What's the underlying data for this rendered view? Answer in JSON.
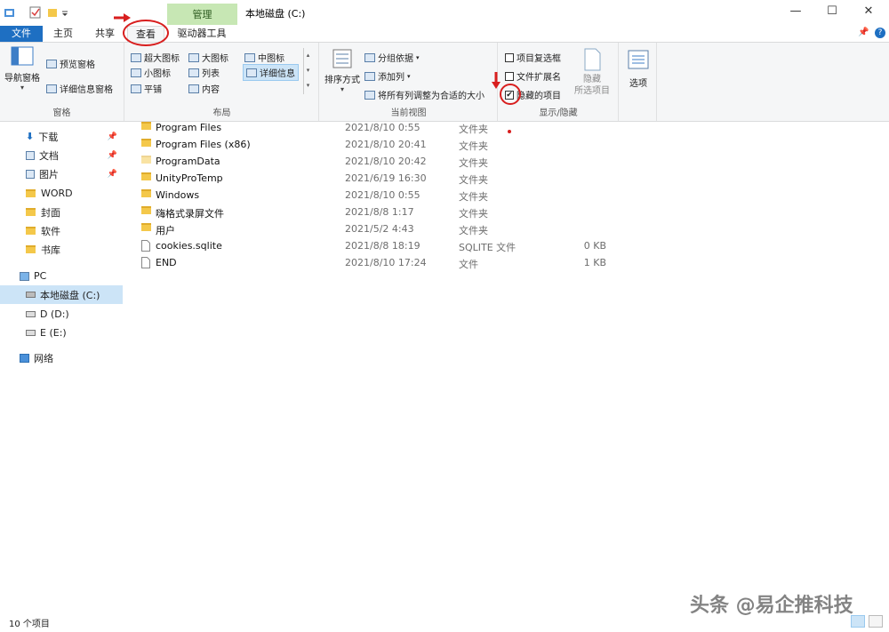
{
  "window": {
    "context_tab": "管理",
    "title": "本地磁盘 (C:)"
  },
  "ribbon_tabs": [
    "文件",
    "主页",
    "共享",
    "查看",
    "驱动器工具"
  ],
  "ribbon": {
    "panes": {
      "label": "窗格",
      "nav_pane": "导航窗格",
      "preview_pane": "预览窗格",
      "details_pane": "详细信息窗格"
    },
    "layout": {
      "label": "布局",
      "items": [
        "超大图标",
        "大图标",
        "中图标",
        "小图标",
        "列表",
        "详细信息",
        "平铺",
        "内容"
      ]
    },
    "current_view": {
      "label": "当前视图",
      "sort_by": "排序方式",
      "group_by": "分组依据",
      "add_column": "添加列",
      "fit_columns": "将所有列调整为合适的大小"
    },
    "show_hide": {
      "label": "显示/隐藏",
      "item_checkboxes": "项目复选框",
      "file_extensions": "文件扩展名",
      "hidden_items": "隐藏的项目",
      "hide_selected_1": "隐藏",
      "hide_selected_2": "所选项目",
      "options": "选项"
    }
  },
  "nav": {
    "quick_access": [
      "下载",
      "文档",
      "图片",
      "WORD",
      "封面",
      "软件",
      "书库"
    ],
    "pc": "PC",
    "drives": [
      "本地磁盘 (C:)",
      "D (D:)",
      "E (E:)"
    ],
    "network": "网络"
  },
  "files": [
    {
      "name": "Program Files",
      "date": "2021/8/10 0:55",
      "type": "文件夹",
      "size": ""
    },
    {
      "name": "Program Files (x86)",
      "date": "2021/8/10 20:41",
      "type": "文件夹",
      "size": ""
    },
    {
      "name": "ProgramData",
      "date": "2021/8/10 20:42",
      "type": "文件夹",
      "size": ""
    },
    {
      "name": "UnityProTemp",
      "date": "2021/6/19 16:30",
      "type": "文件夹",
      "size": ""
    },
    {
      "name": "Windows",
      "date": "2021/8/10 0:55",
      "type": "文件夹",
      "size": ""
    },
    {
      "name": "嗨格式录屏文件",
      "date": "2021/8/8 1:17",
      "type": "文件夹",
      "size": ""
    },
    {
      "name": "用户",
      "date": "2021/5/2 4:43",
      "type": "文件夹",
      "size": ""
    },
    {
      "name": "cookies.sqlite",
      "date": "2021/8/8 18:19",
      "type": "SQLITE 文件",
      "size": "0 KB"
    },
    {
      "name": "END",
      "date": "2021/8/10 17:24",
      "type": "文件",
      "size": "1 KB"
    }
  ],
  "status": {
    "count": "10 个项目"
  },
  "watermark": "头条 @易企推科技",
  "colors": {
    "accent": "#1e6fc2",
    "context_tab": "#c7e7b4",
    "annotation": "#d81e1e",
    "selection": "#cce4f7"
  }
}
